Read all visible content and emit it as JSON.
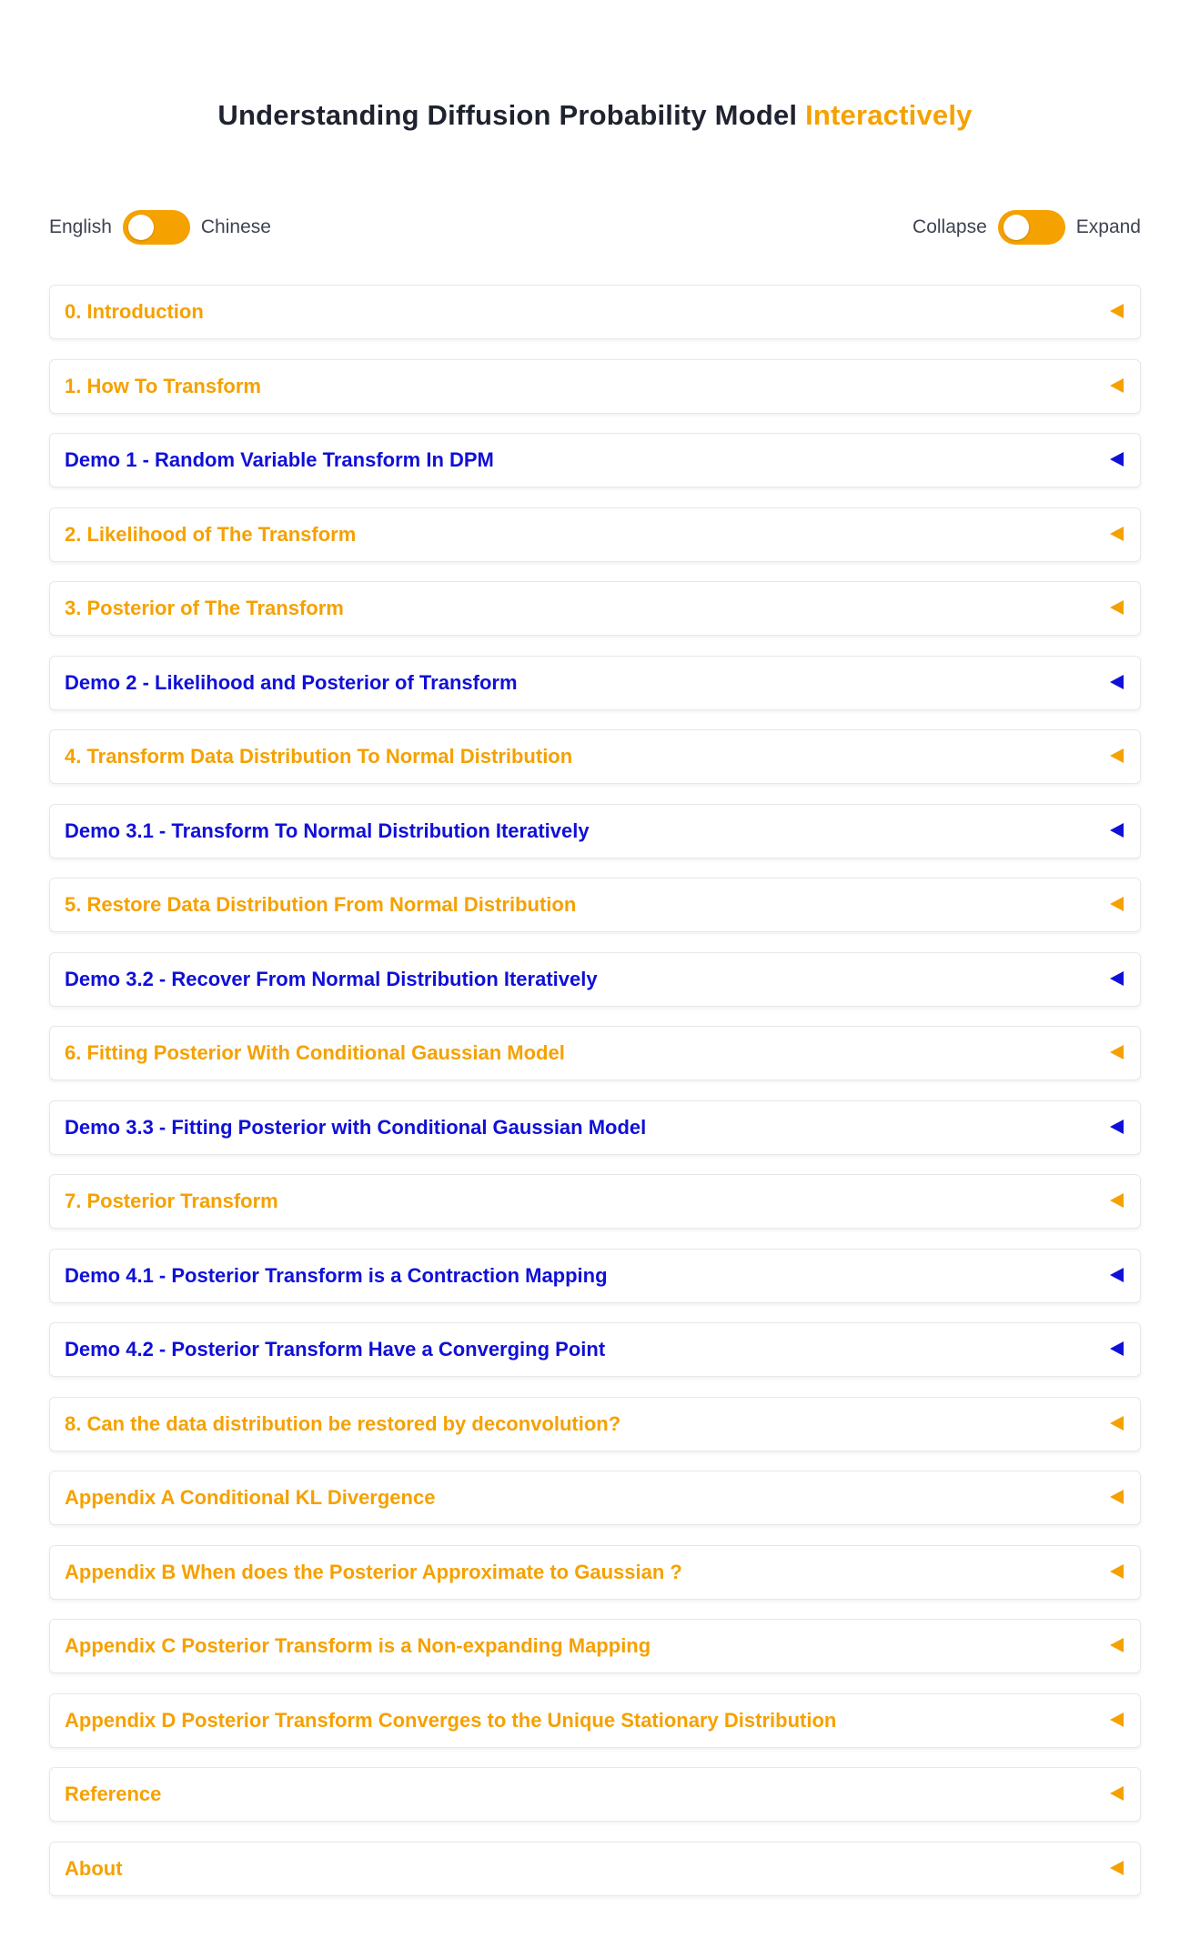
{
  "header": {
    "title_main": "Understanding Diffusion Probability Model",
    "title_accent": "Interactively"
  },
  "language_toggle": {
    "left_label": "English",
    "right_label": "Chinese"
  },
  "expand_toggle": {
    "left_label": "Collapse",
    "right_label": "Expand"
  },
  "colors": {
    "accent": "#f5a100",
    "demo": "#1010d8"
  },
  "sections": [
    {
      "label": "0. Introduction",
      "kind": "chapter",
      "state": "collapsed"
    },
    {
      "label": "1. How To Transform",
      "kind": "chapter",
      "state": "collapsed"
    },
    {
      "label": "Demo 1 - Random Variable Transform In DPM",
      "kind": "demo",
      "state": "collapsed"
    },
    {
      "label": "2. Likelihood of The Transform",
      "kind": "chapter",
      "state": "collapsed"
    },
    {
      "label": "3. Posterior of The Transform",
      "kind": "chapter",
      "state": "collapsed"
    },
    {
      "label": "Demo 2 - Likelihood and Posterior of Transform",
      "kind": "demo",
      "state": "collapsed"
    },
    {
      "label": "4. Transform Data Distribution To Normal Distribution",
      "kind": "chapter",
      "state": "collapsed"
    },
    {
      "label": "Demo 3.1 - Transform To Normal Distribution Iteratively",
      "kind": "demo",
      "state": "collapsed"
    },
    {
      "label": "5. Restore Data Distribution From Normal Distribution",
      "kind": "chapter",
      "state": "collapsed"
    },
    {
      "label": "Demo 3.2 - Recover From Normal Distribution Iteratively",
      "kind": "demo",
      "state": "collapsed"
    },
    {
      "label": "6. Fitting Posterior With Conditional Gaussian Model",
      "kind": "chapter",
      "state": "collapsed"
    },
    {
      "label": "Demo 3.3 - Fitting Posterior with Conditional Gaussian Model",
      "kind": "demo",
      "state": "collapsed"
    },
    {
      "label": "7. Posterior Transform",
      "kind": "chapter",
      "state": "collapsed"
    },
    {
      "label": "Demo 4.1 - Posterior Transform is a Contraction Mapping",
      "kind": "demo",
      "state": "collapsed"
    },
    {
      "label": "Demo 4.2 - Posterior Transform Have a Converging Point",
      "kind": "demo",
      "state": "collapsed"
    },
    {
      "label": "8. Can the data distribution be restored by deconvolution?",
      "kind": "chapter",
      "state": "collapsed"
    },
    {
      "label": "Appendix A Conditional KL Divergence",
      "kind": "chapter",
      "state": "collapsed"
    },
    {
      "label": "Appendix B When does the Posterior Approximate to Gaussian ?",
      "kind": "chapter",
      "state": "collapsed"
    },
    {
      "label": "Appendix C Posterior Transform is a Non-expanding Mapping",
      "kind": "chapter",
      "state": "collapsed"
    },
    {
      "label": "Appendix D Posterior Transform Converges to the Unique Stationary Distribution",
      "kind": "chapter",
      "state": "collapsed"
    },
    {
      "label": "Reference",
      "kind": "chapter",
      "state": "collapsed"
    },
    {
      "label": "About",
      "kind": "chapter",
      "state": "collapsed"
    }
  ]
}
